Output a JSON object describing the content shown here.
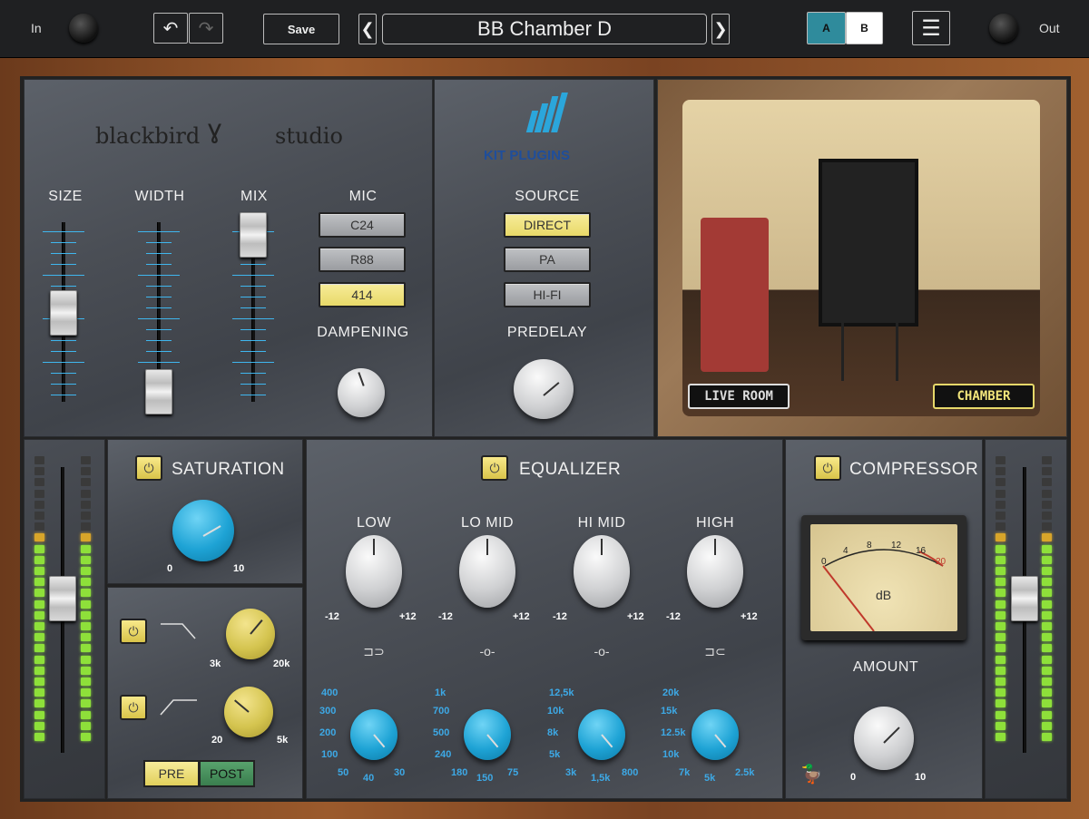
{
  "topbar": {
    "in_label": "In",
    "out_label": "Out",
    "save_label": "Save",
    "preset_name": "BB Chamber D",
    "ab_a": "A",
    "ab_b": "B"
  },
  "brands": {
    "studio_logo_left": "blackbird",
    "studio_logo_right": "studio",
    "kit_logo": "KIT PLUGINS"
  },
  "reverb": {
    "size_label": "SIZE",
    "width_label": "WIDTH",
    "mix_label": "MIX",
    "mic_label": "MIC",
    "mic_options": [
      "C24",
      "R88",
      "414"
    ],
    "mic_selected": "414",
    "dampening_label": "DAMPENING",
    "source_label": "SOURCE",
    "source_options": [
      "DIRECT",
      "PA",
      "HI-FI"
    ],
    "source_selected": "DIRECT",
    "predelay_label": "PREDELAY",
    "room_buttons": [
      "LIVE ROOM",
      "CHAMBER"
    ],
    "room_selected": "CHAMBER"
  },
  "saturation": {
    "title": "SATURATION",
    "min": "0",
    "max": "10"
  },
  "filters": {
    "lowpass_min": "3k",
    "lowpass_max": "20k",
    "highpass_min": "20",
    "highpass_max": "5k",
    "pre_label": "PRE",
    "post_label": "POST"
  },
  "equalizer": {
    "title": "EQUALIZER",
    "bands": [
      {
        "label": "LOW",
        "min": "-12",
        "max": "+12",
        "freqs": [
          "400",
          "300",
          "200",
          "100",
          "50",
          "40",
          "30"
        ]
      },
      {
        "label": "LO MID",
        "min": "-12",
        "max": "+12",
        "freqs": [
          "1k",
          "700",
          "500",
          "240",
          "180",
          "150",
          "75"
        ]
      },
      {
        "label": "HI MID",
        "min": "-12",
        "max": "+12",
        "freqs": [
          "12,5k",
          "10k",
          "8k",
          "5k",
          "3k",
          "1,5k",
          "800"
        ]
      },
      {
        "label": "HIGH",
        "min": "-12",
        "max": "+12",
        "freqs": [
          "20k",
          "15k",
          "12.5k",
          "10k",
          "7k",
          "5k",
          "2.5k"
        ]
      }
    ]
  },
  "compressor": {
    "title": "COMPRESSOR",
    "amount_label": "AMOUNT",
    "min": "0",
    "max": "10",
    "meter_unit": "dB",
    "meter_scale": [
      "0",
      "4",
      "8",
      "12",
      "16",
      "20"
    ]
  },
  "colors": {
    "accent_blue": "#1ea3d5",
    "accent_yellow": "#f3e48d",
    "ab_active": "#2f8b9c"
  }
}
